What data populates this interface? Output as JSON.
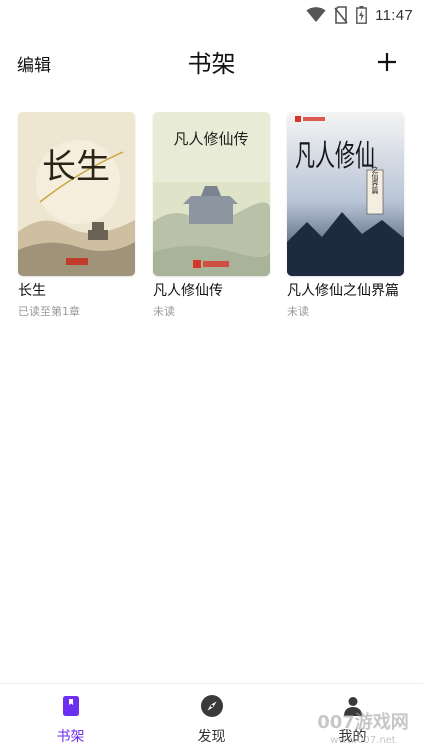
{
  "status_bar": {
    "time": "11:47",
    "icons": [
      "wifi-icon",
      "no-sim-icon",
      "battery-charging-icon"
    ]
  },
  "header": {
    "edit_label": "编辑",
    "title": "书架",
    "add_icon": "plus-icon"
  },
  "books": [
    {
      "title": "长生",
      "progress": "已读至第1章",
      "cover_text": "长生"
    },
    {
      "title": "凡人修仙传",
      "progress": "未读",
      "cover_text": "凡人修仙传"
    },
    {
      "title": "凡人修仙之仙界篇",
      "progress": "未读",
      "cover_text": "凡人修仙",
      "cover_subtitle": "之仙界篇"
    }
  ],
  "bottom_nav": {
    "items": [
      {
        "label": "书架",
        "icon": "book-icon",
        "active": true
      },
      {
        "label": "发现",
        "icon": "compass-icon",
        "active": false
      },
      {
        "label": "我的",
        "icon": "person-icon",
        "active": false
      }
    ]
  },
  "watermark": {
    "text": "007游戏网",
    "url_text": "www.007.net"
  },
  "colors": {
    "accent": "#6c2ef0",
    "text": "#111111",
    "muted": "#999999"
  }
}
